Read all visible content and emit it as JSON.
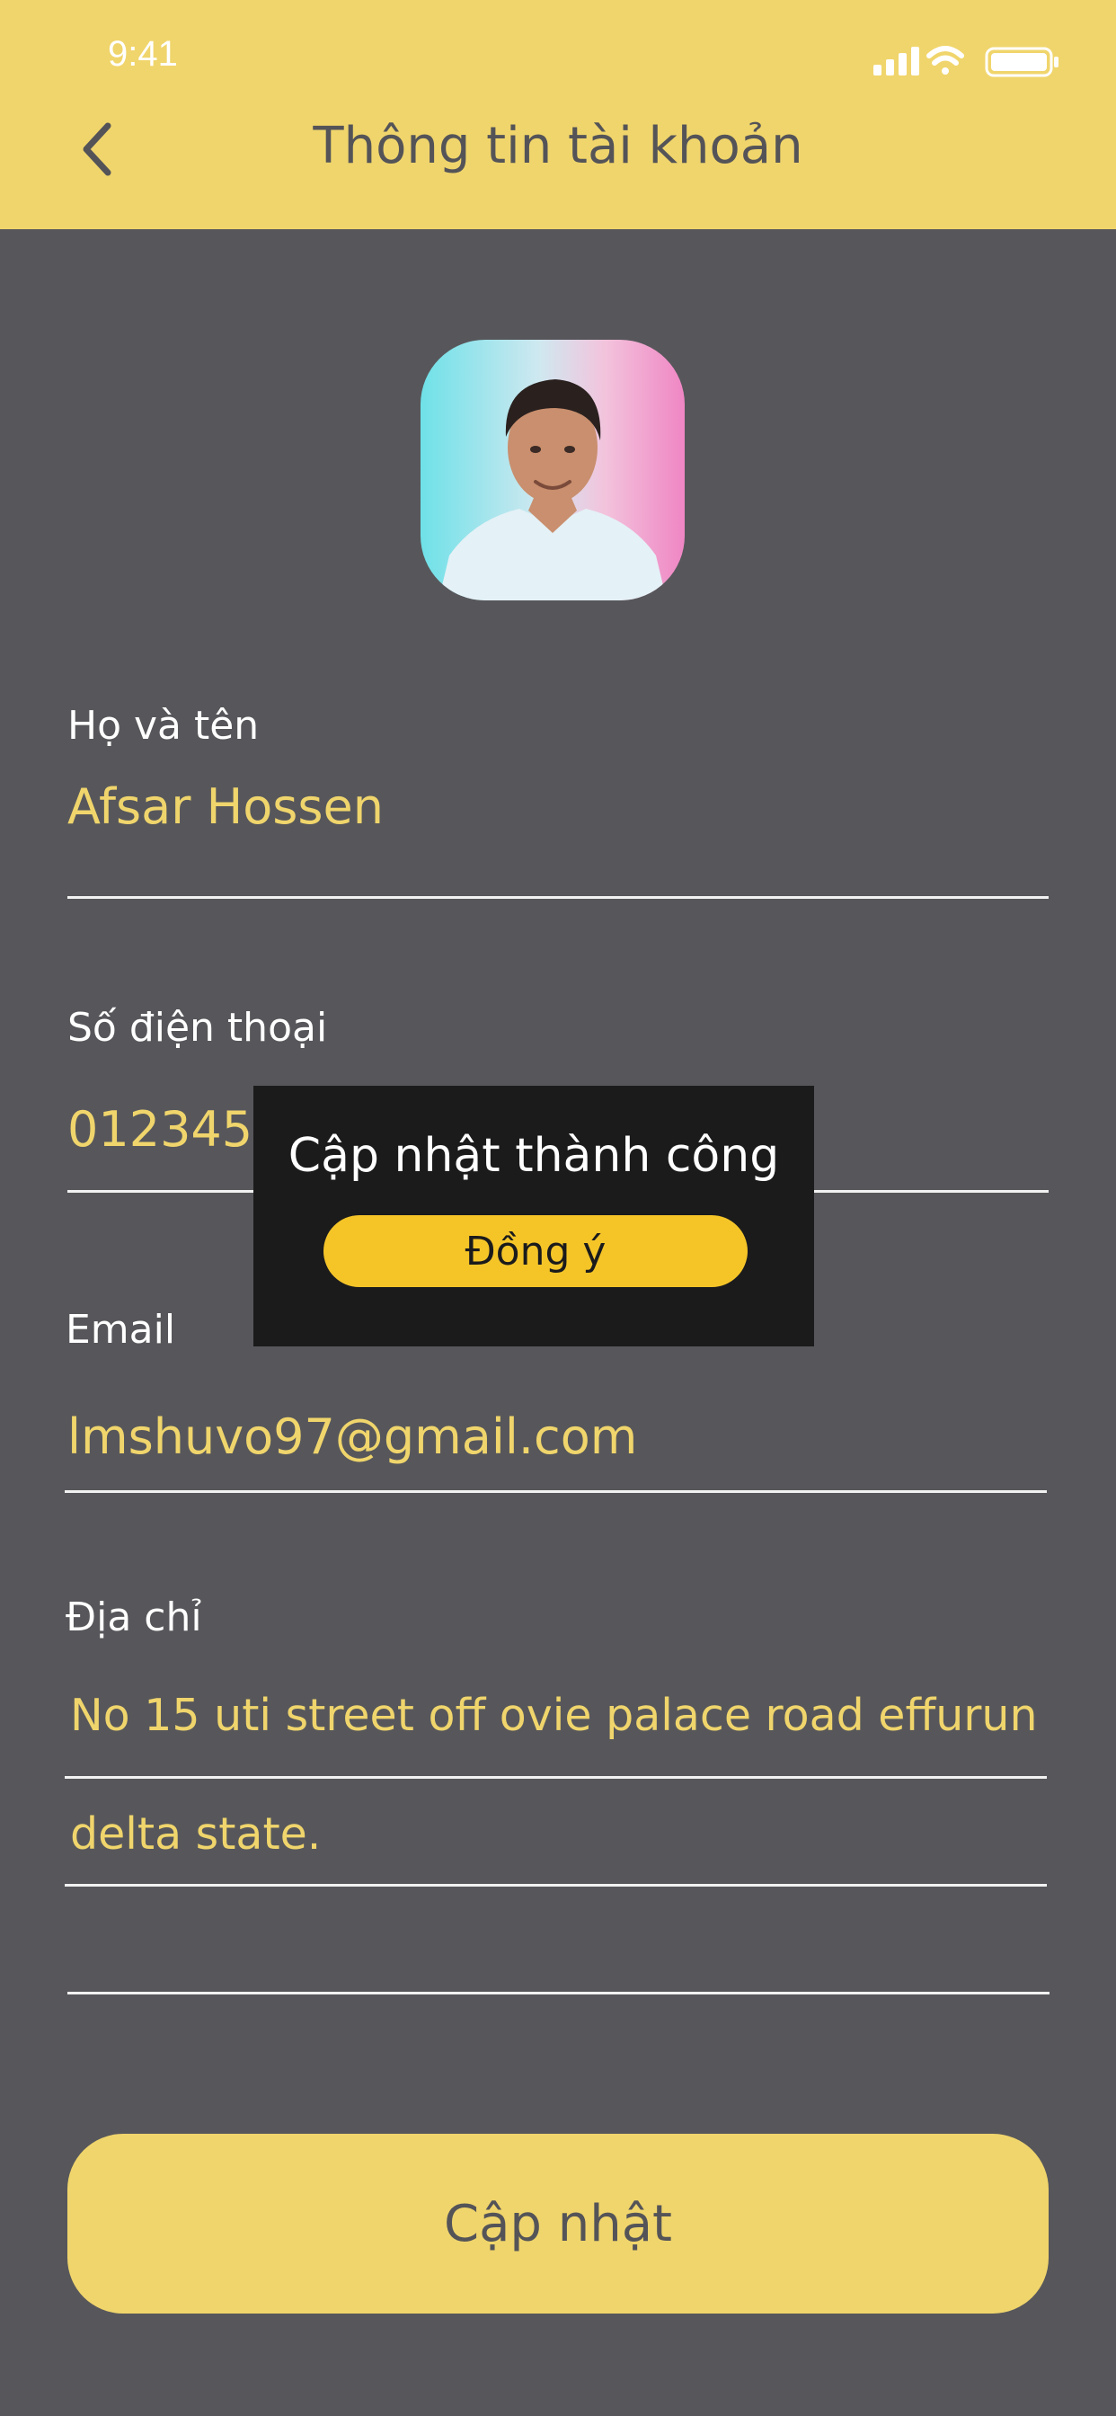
{
  "status_bar": {
    "time": "9:41"
  },
  "header": {
    "title": "Thông tin tài khoản"
  },
  "fields": {
    "name": {
      "label": "Họ và tên",
      "value": "Afsar Hossen"
    },
    "phone": {
      "label": "Số điện thoại",
      "value": "0123456"
    },
    "email": {
      "label": "Email",
      "value": "lmshuvo97@gmail.com"
    },
    "address": {
      "label": "Địa chỉ",
      "line1": "No 15 uti street off ovie palace road effurun",
      "line2": "delta state."
    }
  },
  "update_button": {
    "label": "Cập nhật"
  },
  "dialog": {
    "message": "Cập nhật thành công",
    "button": "Đồng ý"
  },
  "colors": {
    "accent": "#f0d56c",
    "background": "#57575b",
    "dialog_bg": "#1b1b1c",
    "dialog_button": "#f5c528"
  }
}
